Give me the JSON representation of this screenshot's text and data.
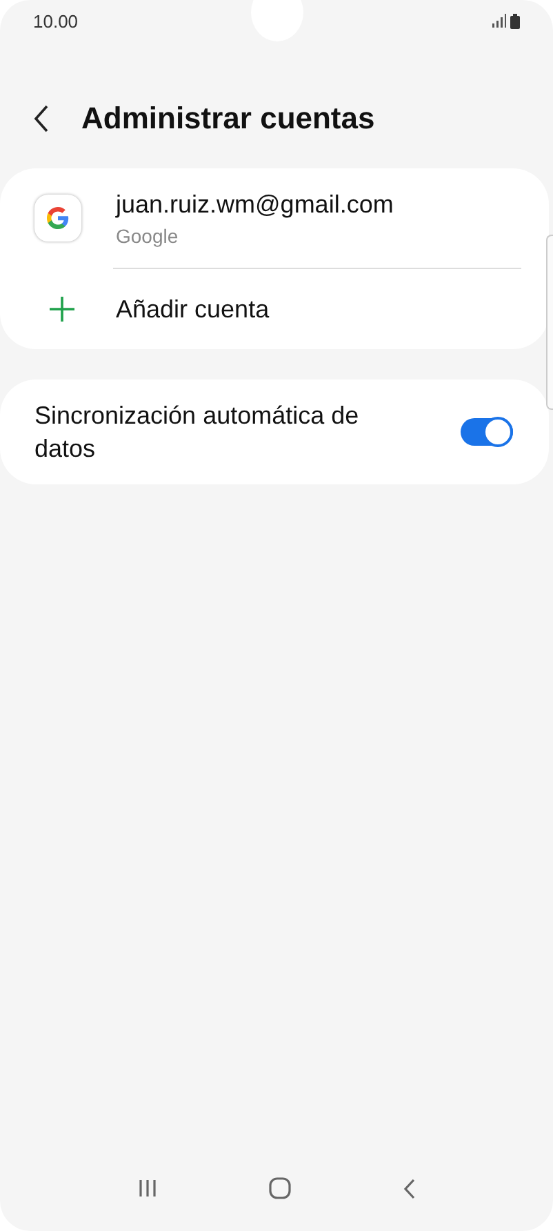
{
  "status_bar": {
    "time": "10.00"
  },
  "header": {
    "title": "Administrar cuentas"
  },
  "accounts": [
    {
      "kind": "account",
      "email": "juan.ruiz.wm@gmail.com",
      "provider": "Google"
    },
    {
      "kind": "add",
      "label": "Añadir cuenta"
    }
  ],
  "settings": [
    {
      "label": "Sincronización automática de datos",
      "on": true
    }
  ]
}
